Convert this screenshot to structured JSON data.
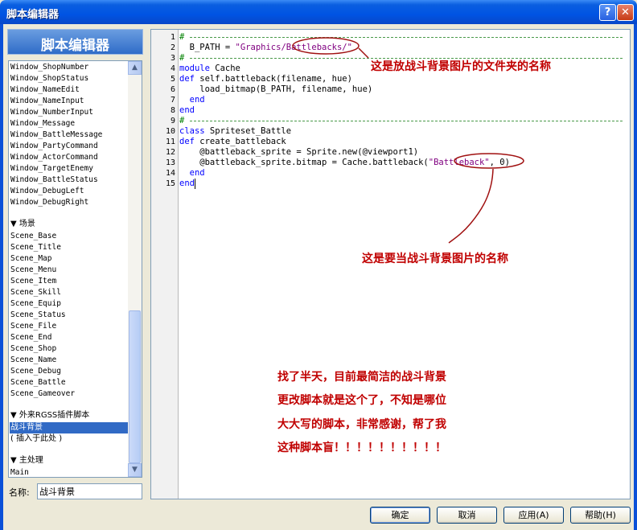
{
  "window": {
    "title": "脚本编辑器",
    "help_glyph": "?",
    "close_glyph": "✕"
  },
  "sidebar": {
    "header": "脚本编辑器",
    "items": [
      "Window_ShopNumber",
      "Window_ShopStatus",
      "Window_NameEdit",
      "Window_NameInput",
      "Window_NumberInput",
      "Window_Message",
      "Window_BattleMessage",
      "Window_PartyCommand",
      "Window_ActorCommand",
      "Window_TargetEnemy",
      "Window_BattleStatus",
      "Window_DebugLeft",
      "Window_DebugRight"
    ],
    "section_scenes": "▼ 场景",
    "scenes": [
      "Scene_Base",
      "Scene_Title",
      "Scene_Map",
      "Scene_Menu",
      "Scene_Item",
      "Scene_Skill",
      "Scene_Equip",
      "Scene_Status",
      "Scene_File",
      "Scene_End",
      "Scene_Shop",
      "Scene_Name",
      "Scene_Debug",
      "Scene_Battle",
      "Scene_Gameover"
    ],
    "section_plugins": "▼ 外来RGSS插件脚本",
    "plugins": [
      "战斗背景",
      "( 插入于此处 )"
    ],
    "section_main": "▼ 主处理",
    "main": [
      "Main"
    ],
    "selected": "战斗背景"
  },
  "name_field": {
    "label": "名称:",
    "value": "战斗背景"
  },
  "editor": {
    "line_numbers": [
      "1",
      "2",
      "3",
      "4",
      "5",
      "6",
      "7",
      "8",
      "9",
      "10",
      "11",
      "12",
      "13",
      "14",
      "15"
    ],
    "lines": {
      "l2": "  B_PATH = ",
      "l2s": "\"Graphics/Battlebacks/\"",
      "l4a": "module",
      "l4b": " Cache",
      "l5a": "def",
      "l5b": " self.battleback(filename, hue)",
      "l6": "    load_bitmap(B_PATH, filename, hue)",
      "l7": "  end",
      "l8": "end",
      "l10a": "class",
      "l10b": " Spriteset_Battle",
      "l11a": "def",
      "l11b": " create_battleback",
      "l12": "    @battleback_sprite = Sprite.new(@viewport1)",
      "l13": "    @battleback_sprite.bitmap = Cache.battleback(",
      "l13s": "\"Battleback\"",
      "l13e": ", 0)",
      "l14": "  end",
      "l15": "end"
    },
    "annotations": {
      "folder": "这是放战斗背景图片的文件夹的名称",
      "filename": "这是要当战斗背景图片的名称"
    },
    "note_lines": [
      "找了半天，目前最简洁的战斗背景",
      "更改脚本就是这个了，不知是哪位",
      "大大写的脚本，非常感谢，帮了我",
      "这种脚本盲！！！！！！！！！！"
    ],
    "annotation_color": "#c00000"
  },
  "buttons": {
    "ok": "确定",
    "cancel": "取消",
    "apply": "应用(A)",
    "help": "帮助(H)"
  }
}
